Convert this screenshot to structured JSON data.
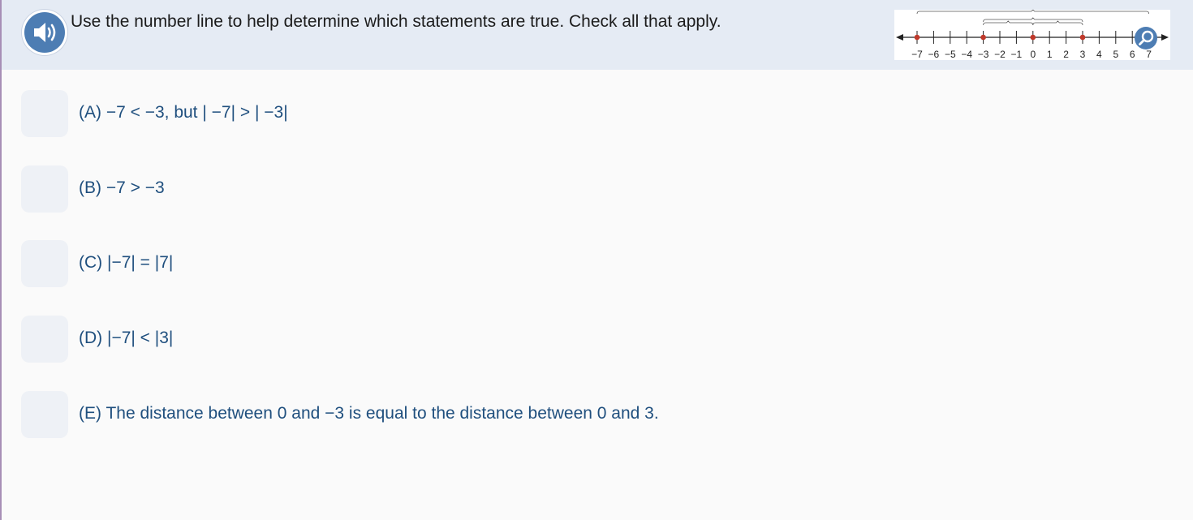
{
  "question": {
    "text": "Use the number line to help determine which statements are true. Check all that apply."
  },
  "audio": {
    "icon": "speaker-icon"
  },
  "number_line": {
    "tick_labels": [
      "−7",
      "−6",
      "−5",
      "−4",
      "−3",
      "−2",
      "−1",
      "0",
      "1",
      "2",
      "3",
      "4",
      "5",
      "6",
      "7"
    ],
    "marked_points": [
      -7,
      -3,
      0,
      3,
      7
    ],
    "point_color": "#c0392b",
    "zoom_icon": "magnifier-icon"
  },
  "options": [
    {
      "label": "(A) −7 < −3, but | −7| > | −3|"
    },
    {
      "label": "(B) −7 > −3"
    },
    {
      "label": "(C) |−7| = |7|"
    },
    {
      "label": "(D) |−7| < |3|"
    },
    {
      "label": "(E) The distance between 0 and −3 is equal to the distance between 0 and 3."
    }
  ],
  "colors": {
    "header_bg": "#e5ebf4",
    "accent": "#4d7db3",
    "option_text": "#1f4f7e",
    "checkbox_bg": "#eef1f6"
  }
}
